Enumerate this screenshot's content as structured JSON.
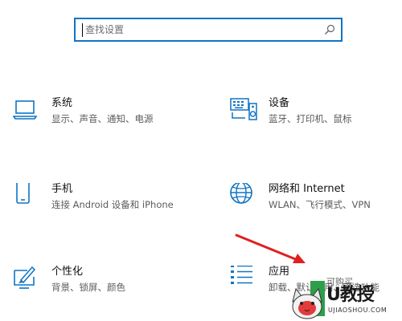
{
  "search": {
    "placeholder": "查找设置",
    "icon": "search-icon"
  },
  "accent_color": "#0f74c4",
  "tiles": {
    "system": {
      "title": "系统",
      "desc": "显示、声音、通知、电源",
      "icon": "laptop-icon"
    },
    "devices": {
      "title": "设备",
      "desc": "蓝牙、打印机、鼠标",
      "icon": "keyboard-speaker-icon"
    },
    "phone": {
      "title": "手机",
      "desc": "连接 Android 设备和 iPhone",
      "icon": "phone-icon"
    },
    "network": {
      "title": "网络和 Internet",
      "desc": "WLAN、飞行模式、VPN",
      "icon": "globe-icon"
    },
    "personal": {
      "title": "个性化",
      "desc": "背景、锁屏、颜色",
      "icon": "paintbrush-icon"
    },
    "apps": {
      "title": "应用",
      "desc": "卸载、默认应用、可选功能",
      "icon": "apps-list-icon"
    }
  },
  "annotation": {
    "arrow_color": "#e02020"
  },
  "watermark": {
    "brand": "U教授",
    "text": "可购买",
    "site": "UJIAOSHOU.COM"
  }
}
